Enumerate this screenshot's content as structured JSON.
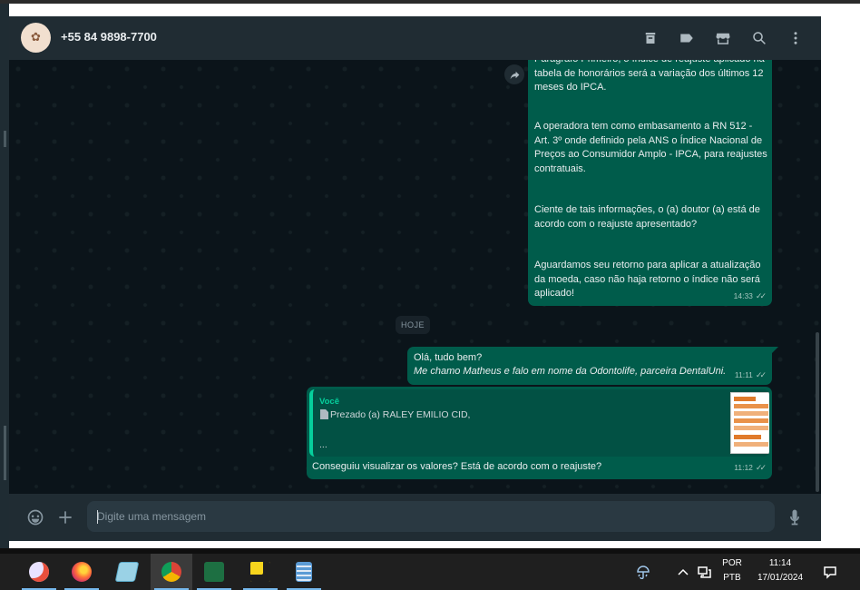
{
  "chat": {
    "contact_name": "+55 84 9898-7700",
    "avatar_label": "✿"
  },
  "header_icons": [
    "delete-icon",
    "label-icon",
    "catalog-icon",
    "search-icon",
    "menu-icon"
  ],
  "messages": {
    "long_message": {
      "p1": "Parágrafo Primeiro, o índice de reajuste aplicado na tabela de honorários será a variação dos últimos 12 meses do IPCA.",
      "p2": "A operadora tem como embasamento a RN 512 - Art. 3º onde definido pela ANS o Índice Nacional de Preços ao Consumidor Amplo - IPCA, para reajustes contratuais.",
      "p3": "Ciente de tais informações, o (a) doutor (a) está de acordo com o reajuste apresentado?",
      "p4": "Aguardamos seu retorno para aplicar a atualização da moeda, caso não haja retorno o índice não será aplicado!",
      "time": "14:33"
    },
    "date_divider": "HOJE",
    "hello_message": {
      "line1": "Olá, tudo bem?",
      "line2": "Me chamo Matheus e falo em nome da Odontolife, parceira DentalUni.",
      "time": "11:11"
    },
    "reply_message": {
      "quote_author": "Você",
      "quote_text": "Prezado (a) RALEY EMILIO CID,",
      "quote_ellipsis": "...",
      "text": "Conseguiu visualizar os valores? Está de acordo com o reajuste?",
      "time": "11:12"
    },
    "ticks": "✓✓"
  },
  "composer": {
    "placeholder": "Digite uma mensagem"
  },
  "taskbar": {
    "apps": [
      "paint-icon",
      "firefox-icon",
      "notepad-icon",
      "chrome-icon",
      "excel-icon",
      "sticky-notes-icon",
      "calculator-icon"
    ],
    "active_app": "chrome-icon",
    "lang_line1": "POR",
    "lang_line2": "PTB",
    "time": "11:14",
    "date": "17/01/2024"
  },
  "colors": {
    "outgoing_bubble": "#005c4b",
    "accent": "#06cf9c",
    "header": "#202c33",
    "background": "#0b141a"
  }
}
